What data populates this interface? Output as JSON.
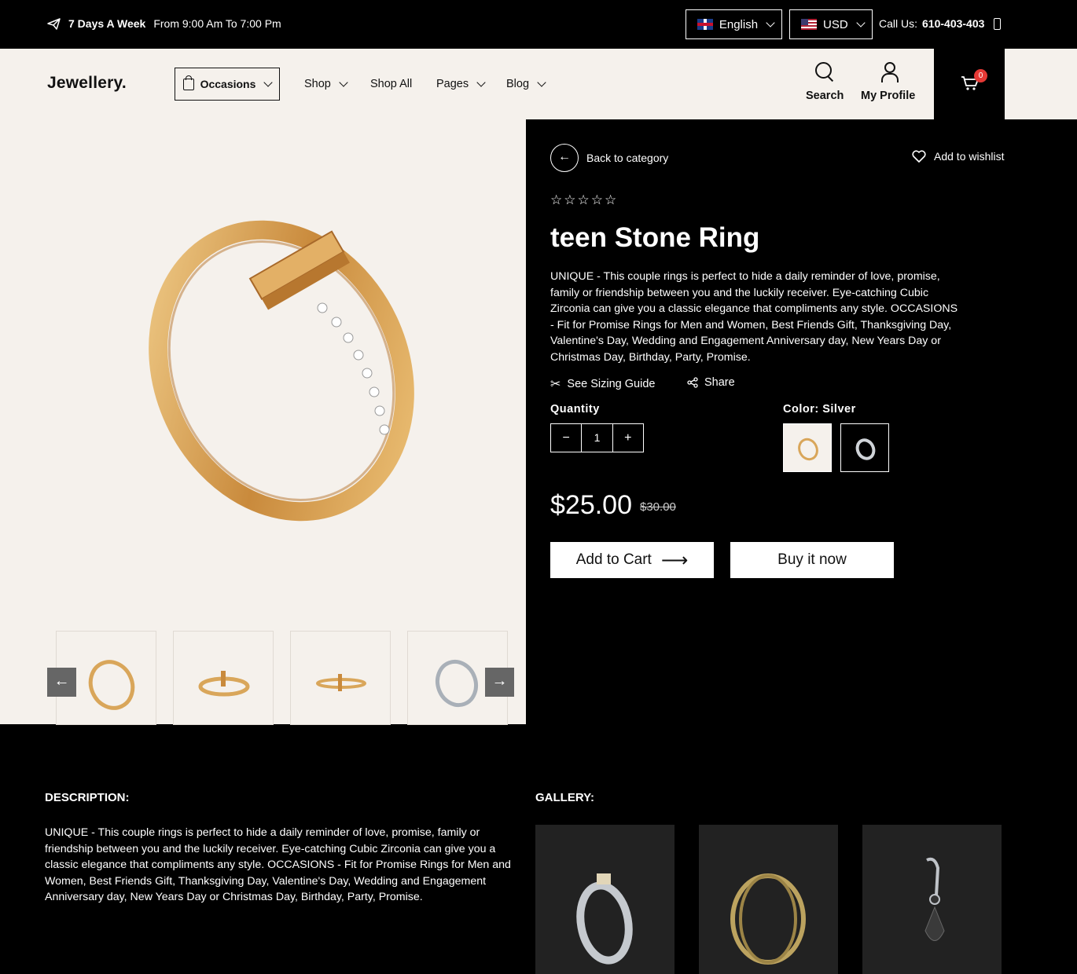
{
  "topbar": {
    "hours_bold": "7 Days A Week",
    "hours_text": "From 9:00 Am To 7:00 Pm",
    "language": "English",
    "currency": "USD",
    "call_label": "Call Us:",
    "call_number": "610-403-403"
  },
  "header": {
    "logo": "Jewellery.",
    "occasions": "Occasions",
    "nav": [
      "Shop",
      "Shop All",
      "Pages",
      "Blog"
    ],
    "search": "Search",
    "profile": "My Profile",
    "cart_count": "0"
  },
  "product": {
    "back": "Back to category",
    "wishlist": "Add to wishlist",
    "stars": "☆☆☆☆☆",
    "title": "teen Stone Ring",
    "description": "UNIQUE - This couple rings is perfect to hide a daily reminder of love, promise, family or friendship between you and the luckily receiver. Eye-catching Cubic Zirconia can give you a classic elegance that compliments any style. OCCASIONS - Fit for Promise Rings for Men and Women, Best Friends Gift, Thanksgiving Day, Valentine's Day, Wedding and Engagement Anniversary day, New Years Day or Christmas Day, Birthday, Party, Promise.",
    "sizing_guide": "See Sizing Guide",
    "share": "Share",
    "quantity_label": "Quantity",
    "quantity_value": "1",
    "color_label": "Color: Silver",
    "price": "$25.00",
    "old_price": "$30.00",
    "add_to_cart": "Add to Cart",
    "buy_now": "Buy it now"
  },
  "bottom": {
    "description_label": "DESCRIPTION:",
    "gallery_label": "GALLERY:",
    "description": "UNIQUE - This couple rings is perfect to hide a daily reminder of love, promise, family or friendship between you and the luckily receiver. Eye-catching Cubic Zirconia can give you a classic elegance that compliments any style. OCCASIONS - Fit for Promise Rings for Men and Women, Best Friends Gift, Thanksgiving Day, Valentine's Day, Wedding and Engagement Anniversary day, New Years Day or Christmas Day, Birthday, Party, Promise."
  },
  "colors": {
    "gold": "#d9a65a",
    "cream": "#f5f1ec",
    "badge": "#e53935"
  }
}
